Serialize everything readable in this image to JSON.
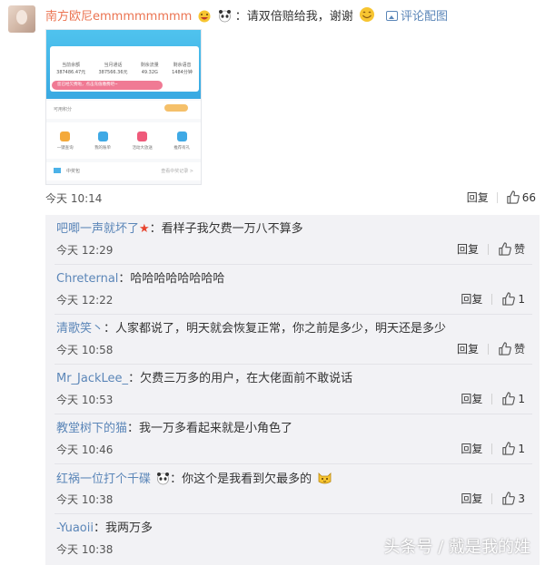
{
  "post": {
    "username": "南方欧尼emmmmmmmm",
    "text": "：请双倍赔给我，谢谢",
    "reply_with_image": "评论配图",
    "time": "今天 10:14",
    "reply_label": "回复",
    "like_count": "66",
    "image": {
      "stats": [
        {
          "label": "当前余额",
          "value": "387486.47元"
        },
        {
          "label": "当月通话",
          "value": "387566.36元"
        },
        {
          "label": "剩余流量",
          "value": "49.32G"
        },
        {
          "label": "剩余语音",
          "value": "1484分钟"
        }
      ],
      "banner": "您已经欠费啦，点击充值缴费吧~",
      "points_label": "可用积分",
      "icons": [
        "一键查询",
        "我的账单",
        "活动大放送",
        "推荐有礼"
      ],
      "bottom_label": "中奖包",
      "bottom_link": "查看中奖记录 >"
    }
  },
  "sub_comments": [
    {
      "user": "吧唧一声就坏了",
      "badge": "★",
      "text": "：看样子我欠费一万八不算多",
      "time": "今天 12:29",
      "reply": "回复",
      "like": "赞"
    },
    {
      "user": "Chreternal",
      "badge": "",
      "text": "：哈哈哈哈哈哈哈哈",
      "time": "今天 12:22",
      "reply": "回复",
      "like": "1"
    },
    {
      "user": "清歌笑丶",
      "badge": "",
      "text": "：人家都说了，明天就会恢复正常，你之前是多少，明天还是多少",
      "time": "今天 10:58",
      "reply": "回复",
      "like": "赞"
    },
    {
      "user": "Mr_JackLee_",
      "badge": "",
      "text": "：欠费三万多的用户，在大佬面前不敢说话",
      "time": "今天 10:53",
      "reply": "回复",
      "like": "1"
    },
    {
      "user": "教堂树下的猫",
      "badge": "",
      "text": "：我一万多看起来就是小角色了",
      "time": "今天 10:46",
      "reply": "回复",
      "like": "1"
    },
    {
      "user": "红祸一位打个千碟",
      "badge": "",
      "text": "：你这个是我看到欠最多的",
      "time": "今天 10:38",
      "reply": "回复",
      "like": "3"
    },
    {
      "user": "-Yuaoii",
      "badge": "",
      "text": "：我两万多",
      "time": "今天 10:38",
      "reply": "",
      "like": ""
    }
  ],
  "watermark": "头条号 / 戴是我的姓",
  "colors": {
    "username": "#eb7350",
    "link": "#5b86b8",
    "sub_bg": "#f2f2f5"
  }
}
